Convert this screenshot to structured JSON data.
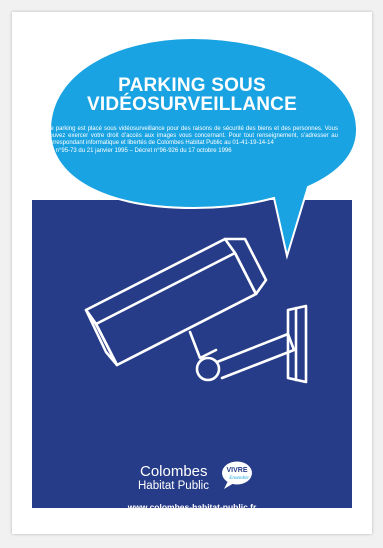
{
  "poster": {
    "title_line1": "PARKING SOUS",
    "title_line2": "VIDÉOSURVEILLANCE",
    "body": "Ce parking est placé sous vidéosurveillance pour des raisons de sécurité des biens et des personnes. Vous pouvez exercer votre droit d’accès aux images vous concernant. Pour tout renseignement, s’adresser au correspondant informatique et libertés de Colombes Habitat Public au 01-41-19-14-14",
    "legal": "Loi n°95-73 du 21 janvier 1995 – Décret n°96-926 du 17 octobre 1996",
    "logo_name": "Colombes",
    "logo_subtitle": "Habitat Public",
    "badge_text": "VIVRE",
    "badge_subtext": "Ensemble",
    "website": "www.colombes-habitat-public.fr"
  },
  "colors": {
    "bubble": "#1aa3e2",
    "panel": "#263c88",
    "text": "#ffffff"
  },
  "icons": {
    "camera": "security-camera-icon",
    "bubble": "speech-bubble"
  }
}
